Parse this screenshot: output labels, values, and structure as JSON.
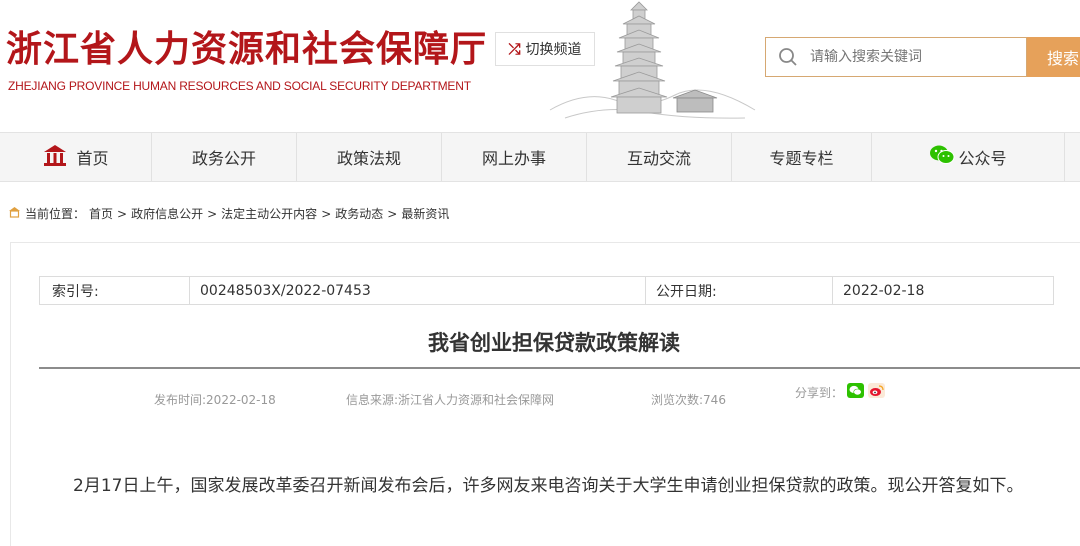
{
  "header": {
    "logo_cn": "浙江省人力资源和社会保障厅",
    "logo_en": "ZHEJIANG PROVINCE HUMAN RESOURCES AND SOCIAL SECURITY DEPARTMENT",
    "switch_label": "切换频道",
    "search_placeholder": "请输入搜索关键词",
    "search_button": "搜索"
  },
  "nav": {
    "items": [
      "首页",
      "政务公开",
      "政策法规",
      "网上办事",
      "互动交流",
      "专题专栏",
      "公众号"
    ]
  },
  "breadcrumb": {
    "label": "当前位置：",
    "items": [
      "首页",
      "政府信息公开",
      "法定主动公开内容",
      "政务动态",
      "最新资讯"
    ],
    "separator": ">"
  },
  "info": {
    "index_label": "索引号:",
    "index_value": "00248503X/2022-07453",
    "date_label": "公开日期:",
    "date_value": "2022-02-18"
  },
  "article": {
    "title": "我省创业担保贷款政策解读",
    "publish_time": "发布时间:2022-02-18",
    "source": "信息来源:浙江省人力资源和社会保障网",
    "views": "浏览次数:746",
    "share_label": "分享到：",
    "body": "2月17日上午，国家发展改革委召开新闻发布会后，许多网友来电咨询关于大学生申请创业担保贷款的政策。现公开答复如下。"
  },
  "colors": {
    "brand_red": "#b3161a",
    "search_orange": "#e6a15a",
    "wechat_green": "#2dc100",
    "weibo_red": "#e6162d"
  }
}
